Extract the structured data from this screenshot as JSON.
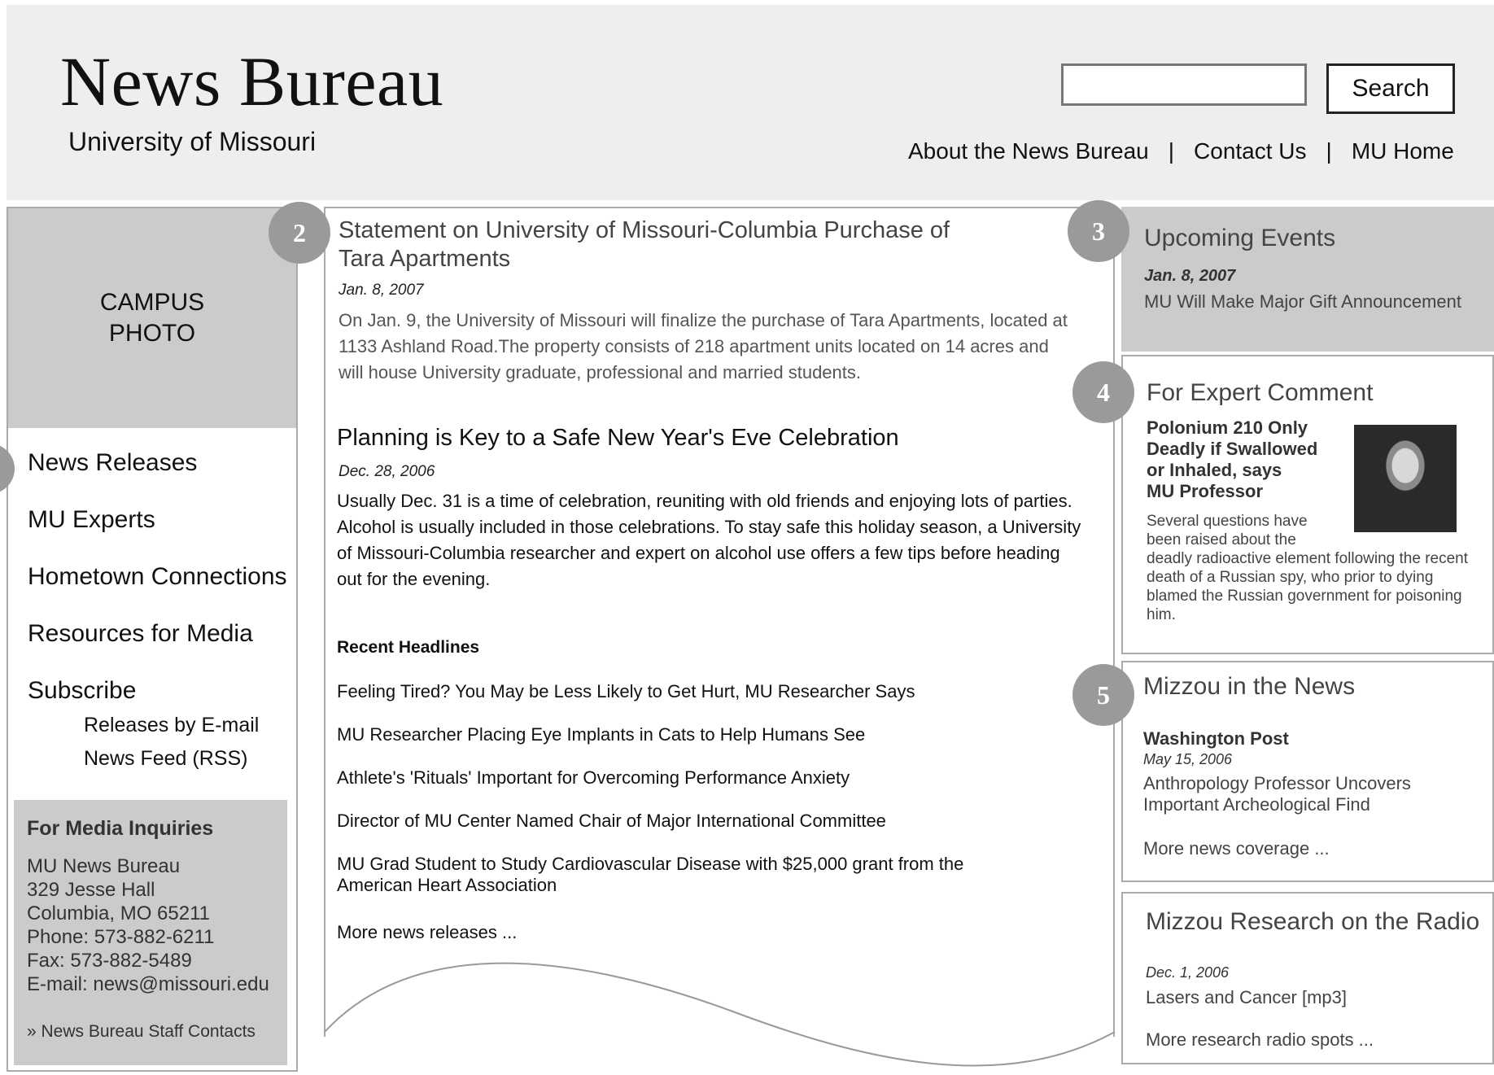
{
  "header": {
    "site_title": "News Bureau",
    "site_subtitle": "University of Missouri",
    "search_placeholder": "",
    "search_button": "Search",
    "nav": [
      "About the News Bureau",
      "Contact Us",
      "MU Home"
    ],
    "nav_separator": "|"
  },
  "sidebar": {
    "photo_label_line1": "CAMPUS",
    "photo_label_line2": "PHOTO",
    "nav": [
      "News Releases",
      "MU Experts",
      "Hometown Connections",
      "Resources for Media",
      "Subscribe"
    ],
    "subscribe_options": [
      "Releases by E-mail",
      "News Feed (RSS)"
    ],
    "media": {
      "heading": "For Media Inquiries",
      "lines": [
        "MU News Bureau",
        "329 Jesse Hall",
        "Columbia, MO 65211",
        "Phone: 573-882-6211",
        "Fax: 573-882-5489",
        "E-mail: news@missouri.edu"
      ],
      "staff_link": "» News Bureau Staff Contacts"
    }
  },
  "main": {
    "articles": [
      {
        "title_line1": "Statement on University of Missouri-Columbia Purchase of",
        "title_line2": "Tara Apartments",
        "date": "Jan. 8, 2007",
        "body": "On Jan. 9, the University of Missouri will finalize the purchase of Tara Apartments, located at 1133 Ashland Road.The property consists of 218 apartment units located on 14 acres and will house University graduate, professional and married students."
      },
      {
        "title": "Planning is Key to a Safe New Year's Eve Celebration",
        "date": "Dec. 28, 2006",
        "body": "Usually Dec. 31 is a time of celebration, reuniting with old friends and enjoying lots of parties. Alcohol is usually included in those celebrations. To stay safe this holiday season, a University of Missouri-Columbia researcher and expert on alcohol use offers a few tips before heading out for the evening."
      }
    ],
    "recent_heading": "Recent Headlines",
    "headlines": [
      "Feeling Tired? You May be Less Likely to Get Hurt, MU Researcher Says",
      "MU Researcher Placing Eye Implants in Cats to Help Humans See",
      "Athlete's 'Rituals' Important for Overcoming Performance Anxiety",
      "Director of MU Center Named Chair of Major International Committee",
      "MU Grad Student to Study Cardiovascular Disease with $25,000 grant from the American Heart Association"
    ],
    "more_link": "More news releases ..."
  },
  "right": {
    "events": {
      "title": "Upcoming Events",
      "date": "Jan. 8, 2007",
      "item": "MU Will Make Major Gift Announcement"
    },
    "expert": {
      "title": "For Expert Comment",
      "headline_lines": [
        "Polonium 210 Only",
        "Deadly if Swallowed",
        "or Inhaled, says",
        "MU Professor"
      ],
      "body_lines": [
        "Several questions have",
        "been raised about the",
        "deadly radioactive element following the recent",
        "death of a Russian spy, who prior to dying",
        "blamed the Russian government for poisoning",
        "him."
      ]
    },
    "mizzou_news": {
      "title": "Mizzou in the News",
      "source": "Washington Post",
      "date": "May 15, 2006",
      "headline_lines": [
        "Anthropology Professor Uncovers",
        "Important Archeological Find"
      ],
      "more": "More news coverage ..."
    },
    "radio": {
      "title": "Mizzou Research on the Radio",
      "date": "Dec. 1, 2006",
      "item": "Lasers and Cancer [mp3]",
      "more": "More research radio spots ..."
    }
  },
  "markers": [
    "2",
    "3",
    "4",
    "5"
  ]
}
